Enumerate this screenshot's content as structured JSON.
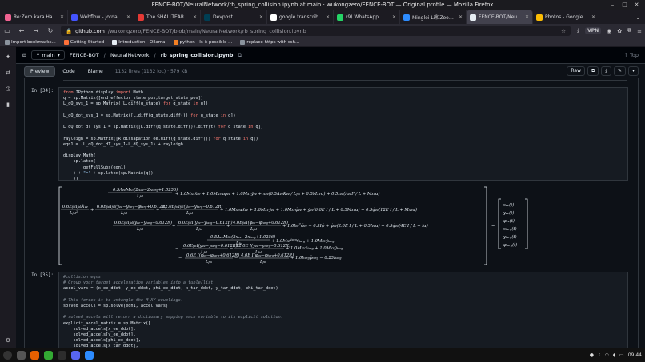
{
  "window": {
    "title": "FENCE-BOT/NeuralNetwork/rb_spring_collision.ipynb at main · wukongzero/FENCE-BOT — Original profile — Mozilla Firefox"
  },
  "tabs": [
    {
      "label": "Re:Zero kara Hajimeru",
      "color": "#f06292"
    },
    {
      "label": "Webflow - Jordan Irgan",
      "color": "#4353ff"
    },
    {
      "label": "The SHALLTEAR BLOOD",
      "color": "#e53935"
    },
    {
      "label": "Devpost",
      "color": "#003e54"
    },
    {
      "label": "google transcribe - Goo",
      "color": "#ffffff"
    },
    {
      "label": "(9) WhatsApp",
      "color": "#25d366"
    },
    {
      "label": "Minglei Li和Zoom的会",
      "color": "#2d8cff"
    },
    {
      "label": "FENCE-BOT/NeuralNetw",
      "color": "#e6edf3",
      "active": true
    },
    {
      "label": "Photos - Google Photos",
      "color": "#fbbc04"
    }
  ],
  "nav": {
    "url_host": "github.com",
    "url_path": "/wukongzero/FENCE-BOT/blob/main/NeuralNetwork/rb_spring_collision.ipynb",
    "vpn": "VPN"
  },
  "bookmarks": [
    {
      "label": "Import bookmarks...",
      "color": "#8b949e"
    },
    {
      "label": "Getting Started",
      "color": "#ff7139"
    },
    {
      "label": "Introduction - Ollama",
      "color": "#e6edf3"
    },
    {
      "label": "python - Is it possible ...",
      "color": "#f48024"
    },
    {
      "label": "replace https with ssh...",
      "color": "#8b949e"
    }
  ],
  "gh": {
    "branch": "main",
    "crumb_repo": "FENCE-BOT",
    "crumb_dir": "NeuralNetwork",
    "crumb_file": "rb_spring_collision.ipynb",
    "top": "Top"
  },
  "filebar": {
    "preview": "Preview",
    "code": "Code",
    "blame": "Blame",
    "meta": "1132 lines (1132 loc) · 579 KB",
    "raw": "Raw"
  },
  "cell34": {
    "prompt": "In [34]:"
  },
  "cell35": {
    "prompt": "In [35]:"
  },
  "taskbar": {
    "time": "09:44"
  }
}
